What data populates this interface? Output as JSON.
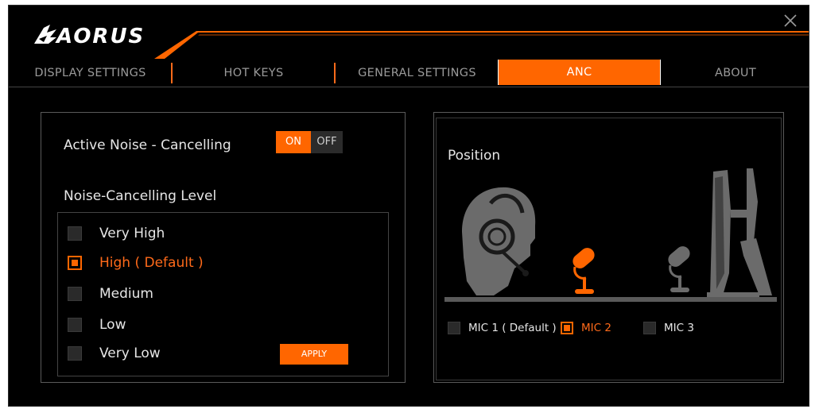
{
  "window": {
    "brand": "AORUS",
    "accent": "#ff6600"
  },
  "tabs": [
    {
      "label": "DISPLAY SETTINGS",
      "active": false
    },
    {
      "label": "HOT KEYS",
      "active": false
    },
    {
      "label": "GENERAL SETTINGS",
      "active": false
    },
    {
      "label": "ANC",
      "active": true
    },
    {
      "label": "ABOUT",
      "active": false
    }
  ],
  "anc": {
    "label": "Active Noise - Cancelling",
    "toggle": {
      "on_label": "ON",
      "off_label": "OFF",
      "state": "ON"
    },
    "level_title": "Noise-Cancelling Level",
    "levels": [
      {
        "label": "Very High",
        "checked": false
      },
      {
        "label": "High ( Default )",
        "checked": true
      },
      {
        "label": "Medium",
        "checked": false
      },
      {
        "label": "Low",
        "checked": false
      },
      {
        "label": "Very Low",
        "checked": false
      }
    ],
    "apply_label": "APPLY"
  },
  "position": {
    "title": "Position",
    "mics": [
      {
        "label": "MIC 1 ( Default )",
        "checked": false
      },
      {
        "label": "MIC 2",
        "checked": true
      },
      {
        "label": "MIC 3",
        "checked": false
      }
    ]
  },
  "icons": {
    "close": "close-icon",
    "logo": "aorus-eagle-logo",
    "head": "headset-user-icon",
    "mic": "microphone-icon",
    "monitor": "monitor-side-icon"
  }
}
